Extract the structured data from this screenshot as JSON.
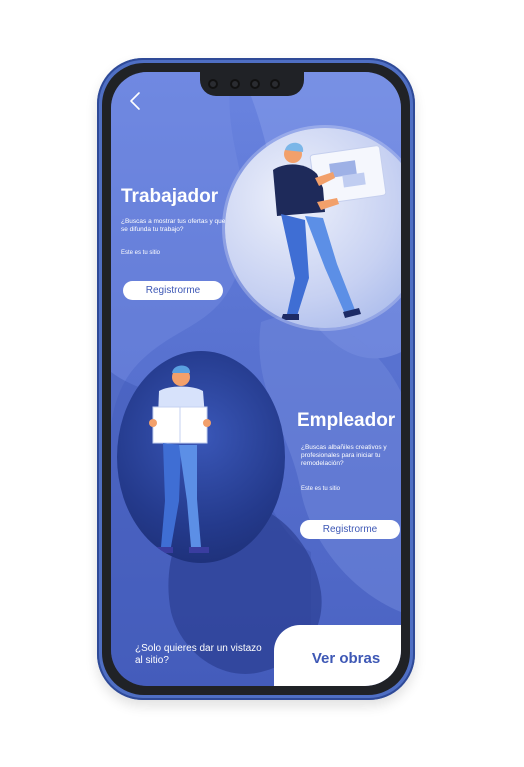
{
  "screen": {
    "back_icon": "chevron-left-icon"
  },
  "trabajador": {
    "title": "Trabajador",
    "description": "¿Buscas a mostrar tus ofertas y que se difunda tu trabajo?",
    "tagline": "Este es tu sitio",
    "button_label": "Registrorme"
  },
  "empleador": {
    "title": "Empleador",
    "description": "¿Buscas albañiles creativos y profesionales para iniciar tu remodelación?",
    "tagline": "Este es tu sitio",
    "button_label": "Registrorme"
  },
  "footer": {
    "question": "¿Solo quieres dar un vistazo al sitio?",
    "cta_label": "Ver obras"
  },
  "colors": {
    "phone_frame": "#4f6fc4",
    "screen_bg": "#5a74d2",
    "accent_text": "#3e58b5"
  }
}
